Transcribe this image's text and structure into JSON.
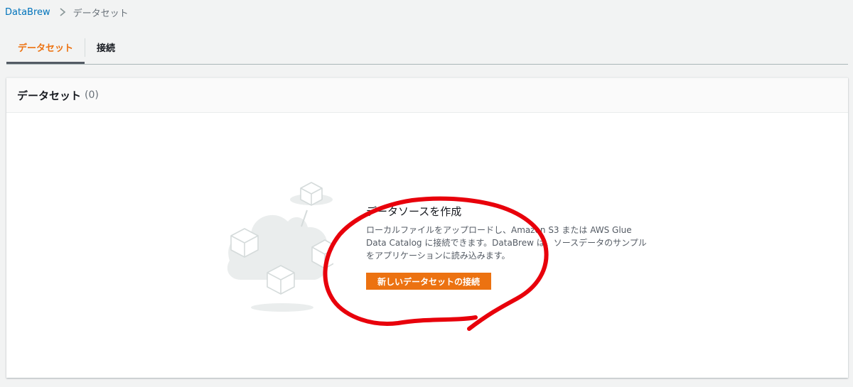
{
  "breadcrumb": {
    "root": "DataBrew",
    "current": "データセット"
  },
  "tabs": [
    {
      "label": "データセット",
      "active": true
    },
    {
      "label": "接続",
      "active": false
    }
  ],
  "panel": {
    "title": "データセット",
    "count": "(0)",
    "empty_state": {
      "title": "データソースを作成",
      "description_lines": [
        "ローカルファイルをアップロードし、Amazon S3 または AWS Glue",
        "Data Catalog に接続できます。DataBrew は、ソースデータのサンプル",
        "をアプリケーションに読み込みます。"
      ],
      "button_label": "新しいデータセットの接続"
    }
  },
  "colors": {
    "accent": "#ec7211",
    "link": "#0073bb",
    "annotation": "#e8000b"
  }
}
